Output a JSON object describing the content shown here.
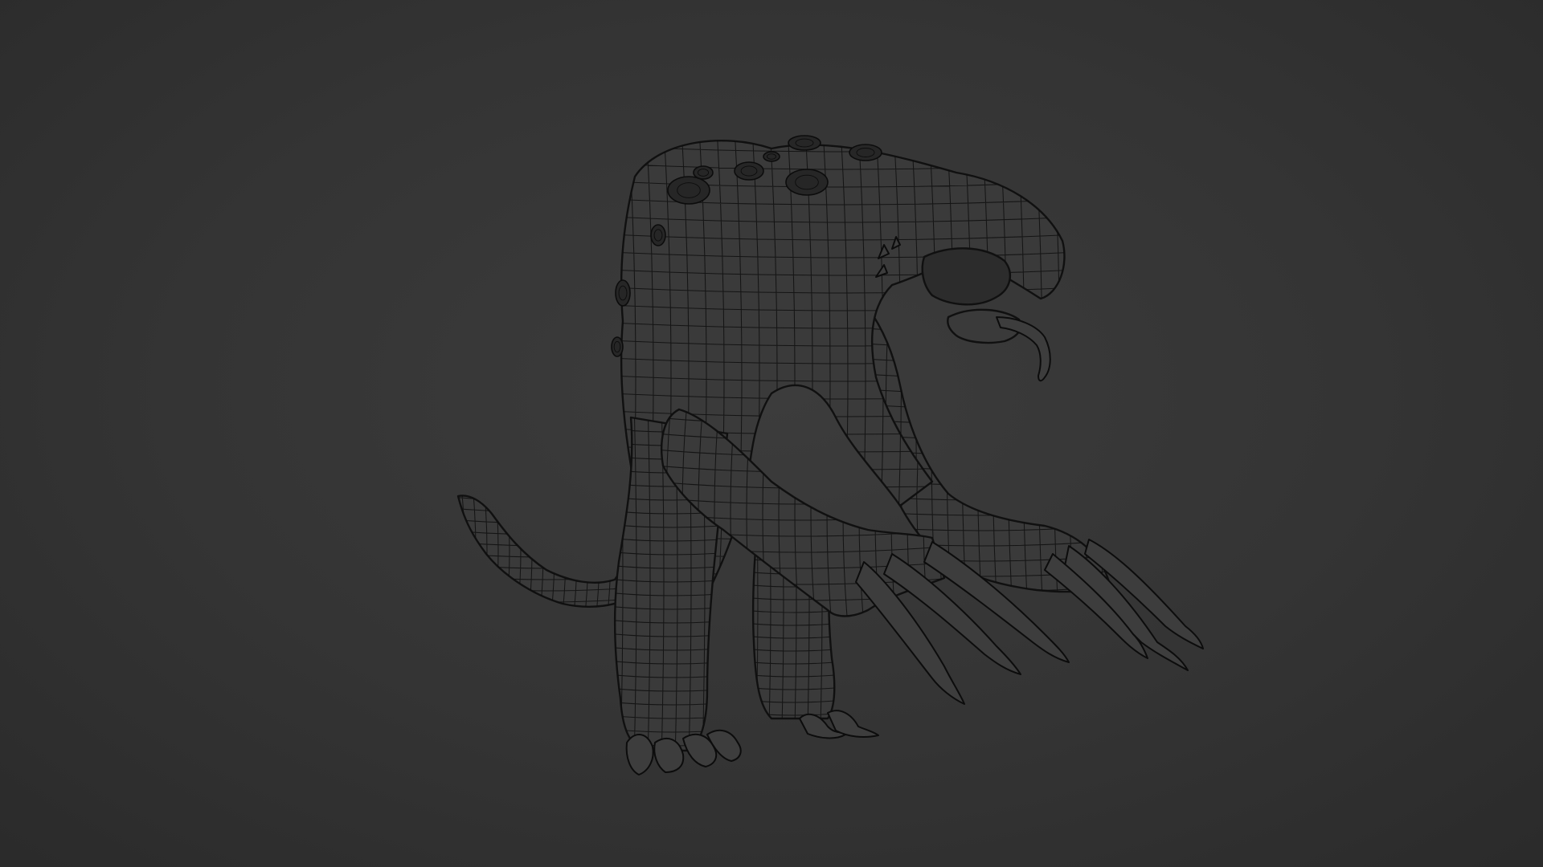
{
  "viewport": {
    "background_color": "#333333",
    "mesh_fill_color": "#3a3a3a",
    "wire_color": "#0e0e0e",
    "display_mode": "wireframe",
    "object": "creature-mesh"
  }
}
